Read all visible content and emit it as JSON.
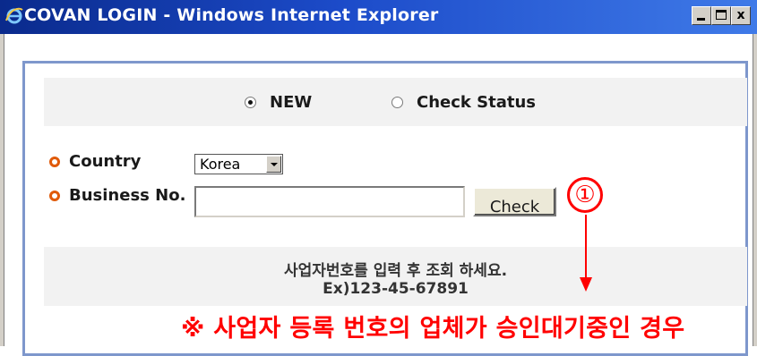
{
  "window": {
    "title": "COVAN LOGIN - Windows Internet Explorer",
    "icon": "ie-icon",
    "controls": {
      "minimize": "minimize",
      "maximize": "maximize",
      "close": "x"
    }
  },
  "mode": {
    "options": [
      {
        "label": "NEW",
        "checked": true
      },
      {
        "label": "Check Status",
        "checked": false
      }
    ]
  },
  "form": {
    "country_label": "Country",
    "country_value": "Korea",
    "business_label": "Business No.",
    "business_value": "",
    "check_button": "Check"
  },
  "info": {
    "line1": "사업자번호를 입력 후 조회 하세요.",
    "line2": "Ex)123-45-67891"
  },
  "annotation": {
    "number": "①",
    "caption": "※ 사업자 등록 번호의 업체가 승인대기중인 경우",
    "color": "#ff0000"
  },
  "colors": {
    "titlebar": "#1c4bc9",
    "frame": "#7e97cc",
    "bullet": "#e05a0a",
    "panel": "#f2f2f2"
  }
}
